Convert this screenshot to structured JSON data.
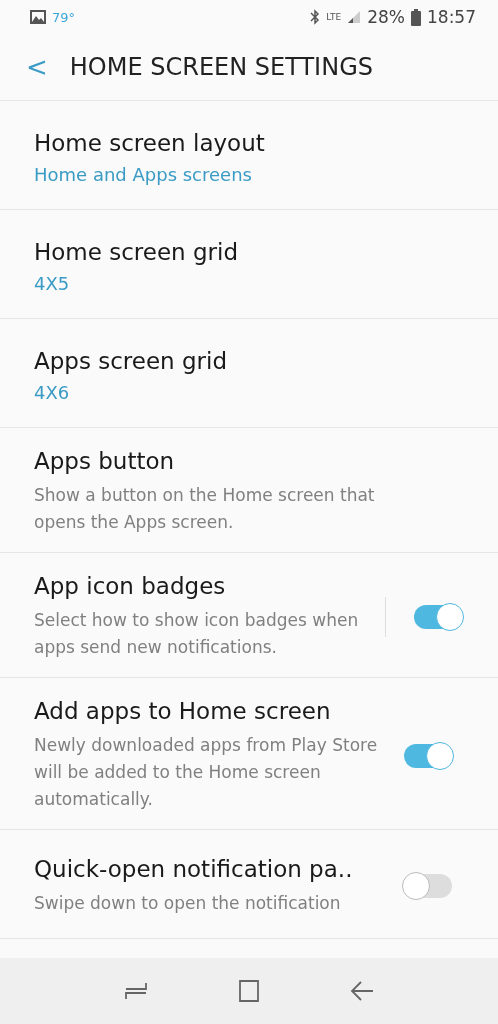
{
  "status_bar": {
    "temperature": "79°",
    "network": "LTE",
    "battery": "28%",
    "time": "18:57"
  },
  "header": {
    "back": "<",
    "title": "HOME SCREEN SETTINGS"
  },
  "settings": [
    {
      "title": "Home screen layout",
      "kind": "value",
      "subtitle": "Home and Apps screens"
    },
    {
      "title": "Home screen grid",
      "kind": "value",
      "subtitle": "4X5"
    },
    {
      "title": "Apps screen grid",
      "kind": "value",
      "subtitle": "4X6"
    },
    {
      "title": "Apps button",
      "kind": "description",
      "subtitle": "Show a button on the Home screen that opens the Apps screen."
    },
    {
      "title": "App icon badges",
      "kind": "description",
      "subtitle": "Select how to show icon badges when apps send new notifications.",
      "toggle": {
        "on": true,
        "divider": true
      }
    },
    {
      "title": "Add apps to Home screen",
      "kind": "description",
      "subtitle": "Newly downloaded apps from Play Store will be added to the Home screen automatically.",
      "toggle": {
        "on": true
      }
    },
    {
      "title": "Quick-open notification pa..",
      "kind": "description",
      "subtitle": "Swipe down to open the notification",
      "toggle": {
        "on": false
      }
    }
  ]
}
